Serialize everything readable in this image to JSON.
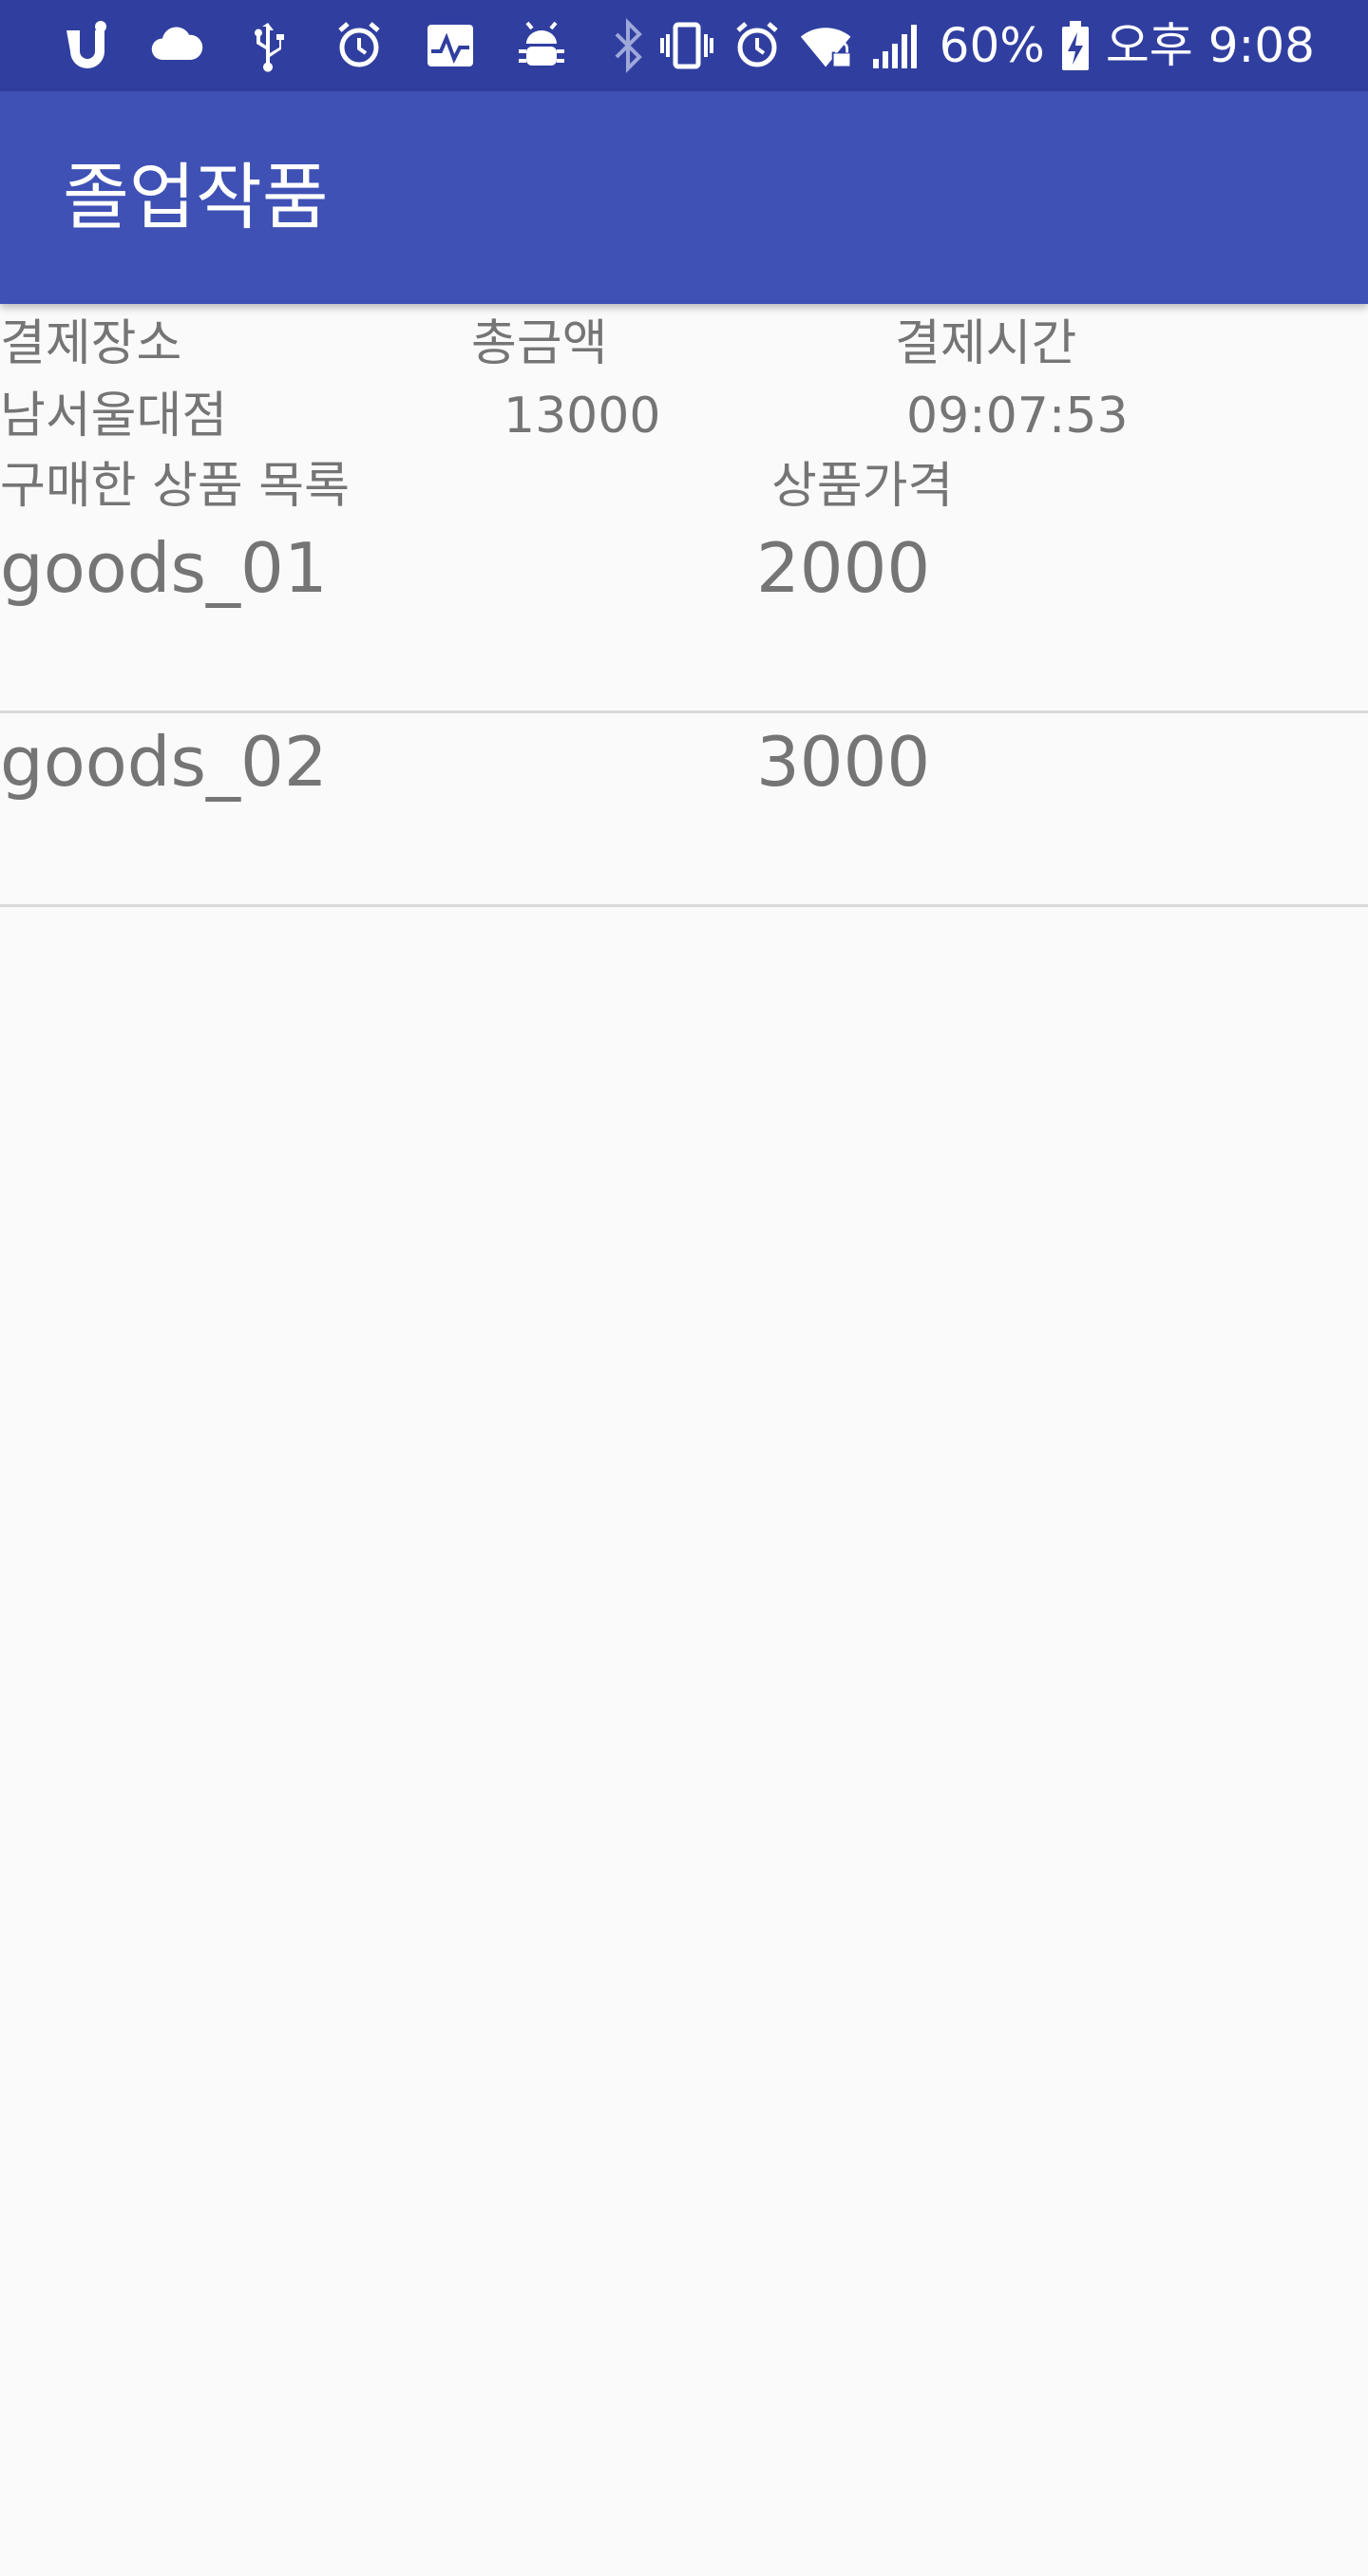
{
  "status_bar": {
    "battery": "60%",
    "time": "오후 9:08",
    "left_icons": [
      "u-plus-icon",
      "cloud-icon",
      "usb-icon",
      "alarm-icon",
      "pulse-icon",
      "android-debug-icon"
    ],
    "right_icons": [
      "bluetooth-icon",
      "vibrate-icon",
      "alarm-icon",
      "wifi-lock-icon",
      "signal-icon",
      "battery-charging-icon"
    ]
  },
  "app_bar": {
    "title": "졸업작품"
  },
  "payment": {
    "headers": {
      "place": "결제장소",
      "total": "총금액",
      "time": "결제시간"
    },
    "values": {
      "place": "남서울대점",
      "total": "13000",
      "time": "09:07:53"
    }
  },
  "goods": {
    "headers": {
      "name": "구매한 상품 목록",
      "price": "상품가격"
    },
    "items": [
      {
        "name": "goods_01",
        "price": "2000"
      },
      {
        "name": "goods_02",
        "price": "3000"
      }
    ]
  },
  "colors": {
    "status_bar": "#303f9f",
    "app_bar": "#3f51b5",
    "background": "#fafafa",
    "text": "#757575",
    "divider": "#d9d9d9"
  }
}
